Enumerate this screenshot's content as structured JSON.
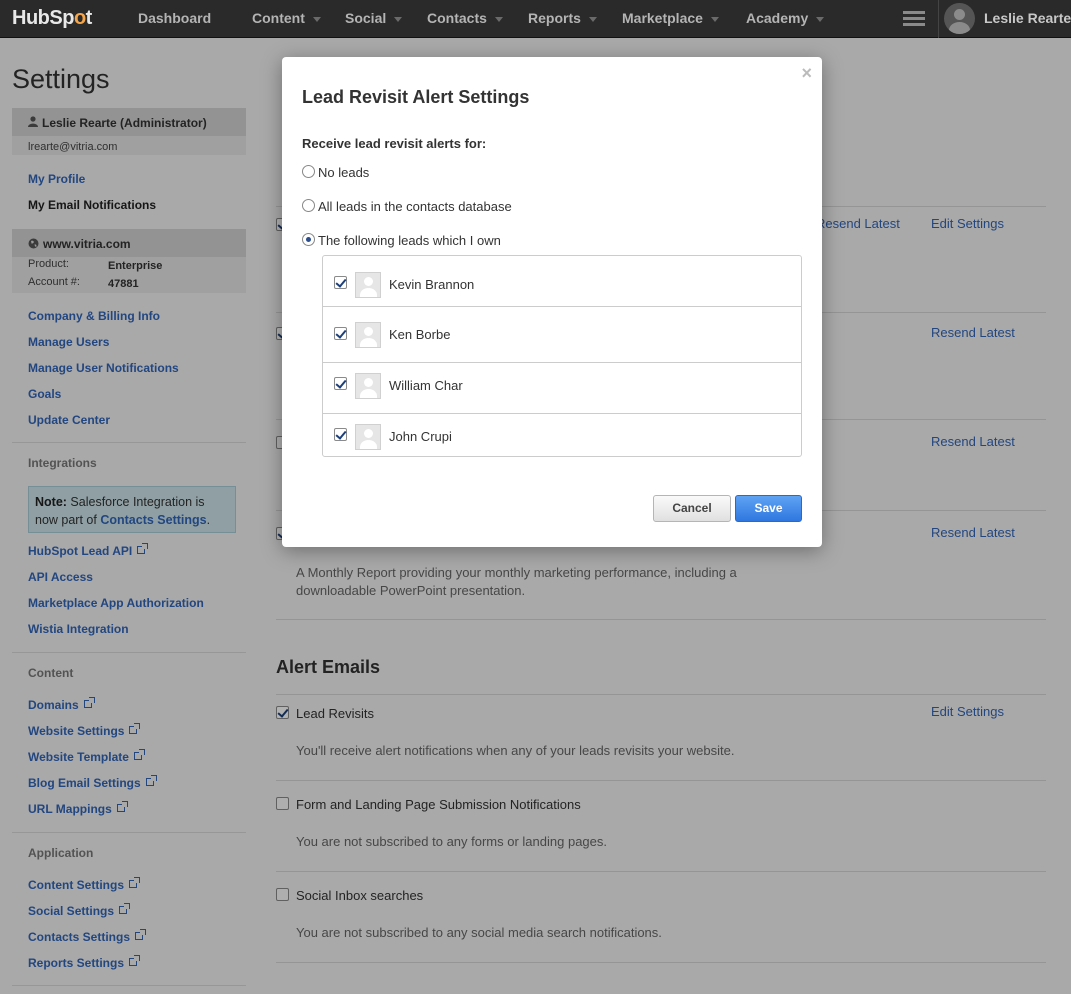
{
  "topnav": {
    "logo_a": "HubSp",
    "logo_b": "o",
    "logo_c": "t",
    "items": [
      "Dashboard",
      "Content",
      "Social",
      "Contacts",
      "Reports",
      "Marketplace",
      "Academy"
    ],
    "user": "Leslie Rearte"
  },
  "page": {
    "title": "Settings"
  },
  "sidebar": {
    "user_name": "Leslie Rearte (Administrator)",
    "user_email": "lrearte@vitria.com",
    "profile_links": [
      "My Profile",
      "My Email Notifications"
    ],
    "site": "www.vitria.com",
    "product_label": "Product:",
    "product_value": "Enterprise",
    "account_label": "Account #:",
    "account_value": "47881",
    "account_links": [
      "Company & Billing Info",
      "Manage Users",
      "Manage User Notifications",
      "Goals",
      "Update Center"
    ],
    "integrations_title": "Integrations",
    "note_bold": "Note:",
    "note_text_1": " Salesforce Integration is now part of ",
    "note_link": "Contacts Settings",
    "note_end": ".",
    "integration_links": [
      "HubSpot Lead API",
      "API Access",
      "Marketplace App Authorization",
      "Wistia Integration"
    ],
    "content_title": "Content",
    "content_links": [
      "Domains",
      "Website Settings",
      "Website Template",
      "Blog Email Settings",
      "URL Mappings"
    ],
    "application_title": "Application",
    "application_links": [
      "Content Settings",
      "Social Settings",
      "Contacts Settings",
      "Reports Settings"
    ]
  },
  "main": {
    "row1_links": [
      "Resend Latest",
      "Edit Settings"
    ],
    "row2_link": "Resend Latest",
    "row3_link": "Resend Latest",
    "row4_link": "Resend Latest",
    "monthly_desc": "A Monthly Report providing your monthly marketing performance, including a downloadable PowerPoint presentation.",
    "alert_title": "Alert Emails",
    "alerts": [
      {
        "label": "Lead Revisits",
        "desc": "You'll receive alert notifications when any of your leads revisits your website.",
        "link": "Edit Settings",
        "checked": true
      },
      {
        "label": "Form and Landing Page Submission Notifications",
        "desc": "You are not subscribed to any forms or landing pages.",
        "checked": false
      },
      {
        "label": "Social Inbox searches",
        "desc": "You are not subscribed to any social media search notifications.",
        "checked": false
      }
    ]
  },
  "modal": {
    "title": "Lead Revisit Alert Settings",
    "close": "×",
    "prompt": "Receive lead revisit alerts for:",
    "options": [
      "No leads",
      "All leads in the contacts database",
      "The following leads which I own"
    ],
    "selected_option": 2,
    "leads": [
      "Kevin Brannon",
      "Ken Borbe",
      "William Char",
      "John Crupi"
    ],
    "cancel": "Cancel",
    "save": "Save"
  }
}
